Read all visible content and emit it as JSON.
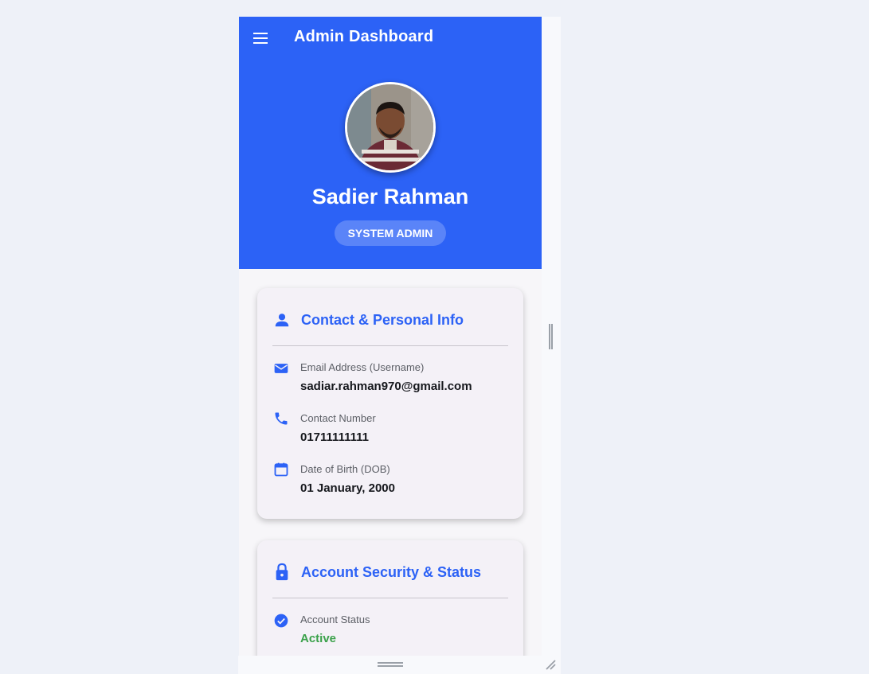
{
  "app": {
    "title": "Admin Dashboard"
  },
  "profile": {
    "name": "Sadier Rahman",
    "role": "SYSTEM ADMIN"
  },
  "contact_card": {
    "title": "Contact & Personal Info",
    "rows": [
      {
        "icon": "mail-icon",
        "label": "Email Address (Username)",
        "value": "sadiar.rahman970@gmail.com"
      },
      {
        "icon": "phone-icon",
        "label": "Contact Number",
        "value": "01711111111"
      },
      {
        "icon": "calendar-icon",
        "label": "Date of Birth (DOB)",
        "value": "01 January, 2000"
      }
    ]
  },
  "security_card": {
    "title": "Account Security & Status",
    "rows": [
      {
        "icon": "check-circle-icon",
        "label": "Account Status",
        "value": "Active"
      }
    ]
  },
  "colors": {
    "primary": "#2c62f6",
    "active": "#3aa14a",
    "background": "#eef1f8",
    "card": "#f4f1f7"
  }
}
